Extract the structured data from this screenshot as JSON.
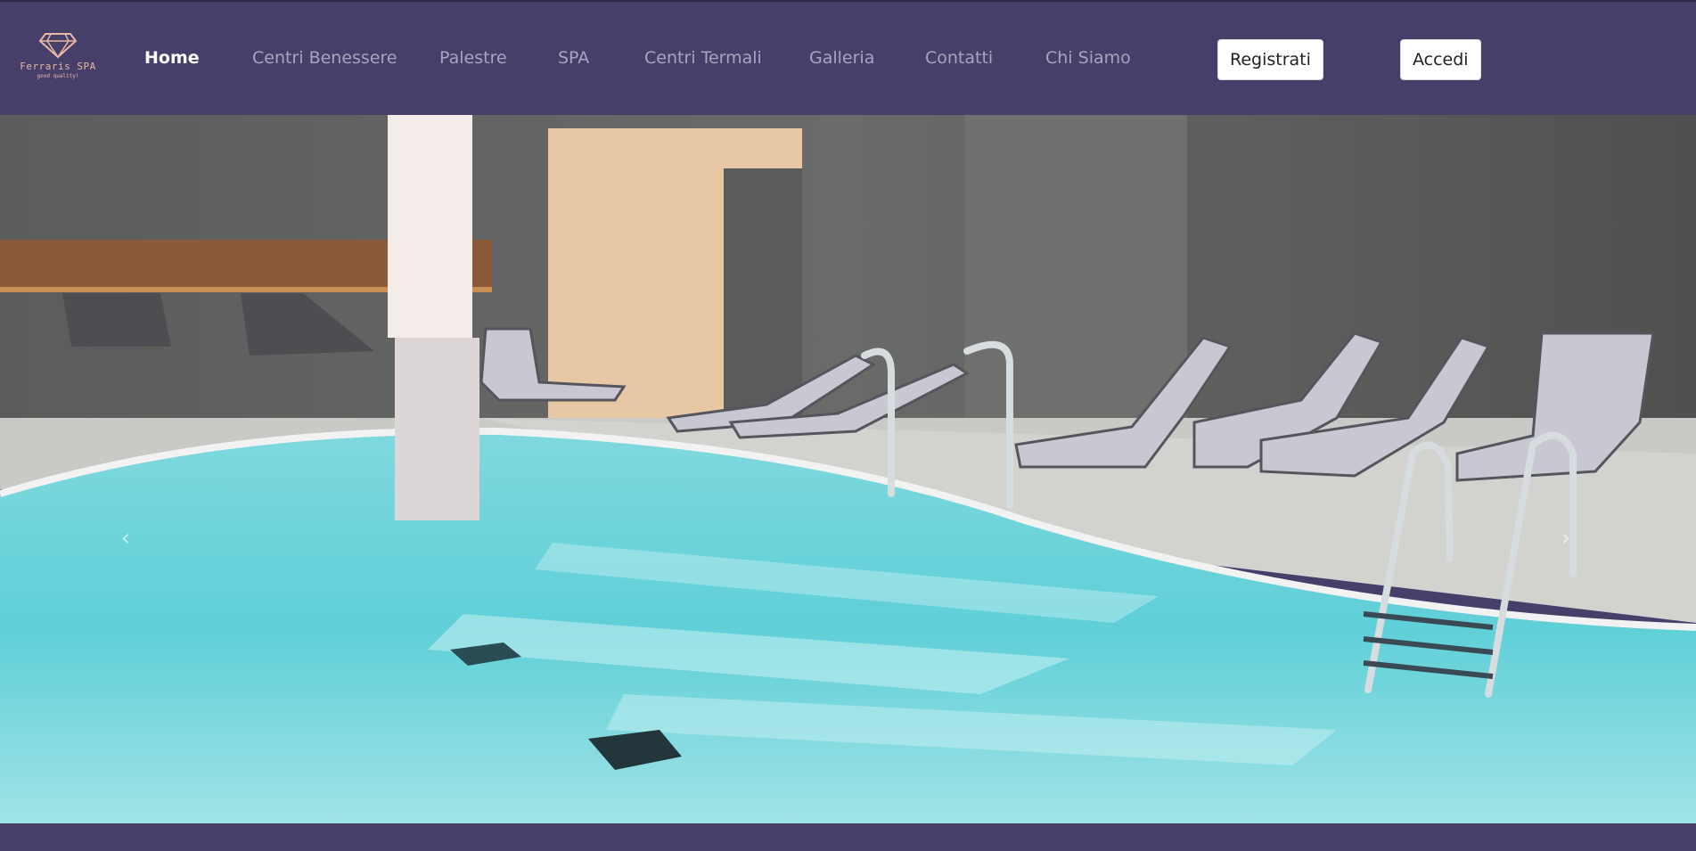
{
  "brand": {
    "name": "Ferraris SPA",
    "tagline": "good quality!",
    "icon": "diamond-logo-icon"
  },
  "nav": {
    "items": [
      {
        "label": "Home",
        "active": true
      },
      {
        "label": "Centri Benessere",
        "active": false
      },
      {
        "label": "Palestre",
        "active": false
      },
      {
        "label": "SPA",
        "active": false
      },
      {
        "label": "Centri Termali",
        "active": false
      },
      {
        "label": "Galleria",
        "active": false
      },
      {
        "label": "Contatti",
        "active": false
      },
      {
        "label": "Chi Siamo",
        "active": false
      }
    ],
    "register_label": "Registrati",
    "login_label": "Accedi"
  },
  "carousel": {
    "prev_icon": "chevron-left-icon",
    "next_icon": "chevron-right-icon",
    "prev_glyph": "‹",
    "next_glyph": "›"
  },
  "colors": {
    "navbar_bg": "#463f6a",
    "nav_link": "#a8a3bf",
    "nav_active": "#ffffff",
    "brand_accent": "#e9b7a3",
    "pool_water": "#5fd3da"
  }
}
